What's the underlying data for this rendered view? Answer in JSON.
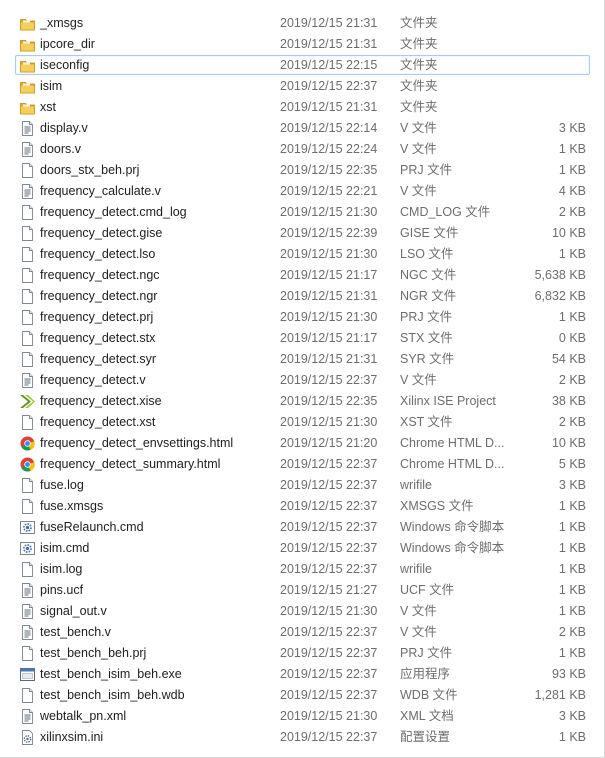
{
  "files": [
    {
      "name": "_xmsgs",
      "date": "2019/12/15 21:31",
      "type": "文件夹",
      "size": "",
      "icon": "folder-icon"
    },
    {
      "name": "ipcore_dir",
      "date": "2019/12/15 21:31",
      "type": "文件夹",
      "size": "",
      "icon": "folder-icon"
    },
    {
      "name": "iseconfig",
      "date": "2019/12/15 22:15",
      "type": "文件夹",
      "size": "",
      "icon": "folder-icon",
      "selected": true
    },
    {
      "name": "isim",
      "date": "2019/12/15 22:37",
      "type": "文件夹",
      "size": "",
      "icon": "folder-icon"
    },
    {
      "name": "xst",
      "date": "2019/12/15 21:31",
      "type": "文件夹",
      "size": "",
      "icon": "folder-icon"
    },
    {
      "name": "display.v",
      "date": "2019/12/15 22:14",
      "type": "V 文件",
      "size": "3 KB",
      "icon": "text-file-icon"
    },
    {
      "name": "doors.v",
      "date": "2019/12/15 22:24",
      "type": "V 文件",
      "size": "1 KB",
      "icon": "text-file-icon"
    },
    {
      "name": "doors_stx_beh.prj",
      "date": "2019/12/15 22:35",
      "type": "PRJ 文件",
      "size": "1 KB",
      "icon": "blank-file-icon"
    },
    {
      "name": "frequency_calculate.v",
      "date": "2019/12/15 22:21",
      "type": "V 文件",
      "size": "4 KB",
      "icon": "text-file-icon"
    },
    {
      "name": "frequency_detect.cmd_log",
      "date": "2019/12/15 21:30",
      "type": "CMD_LOG 文件",
      "size": "2 KB",
      "icon": "blank-file-icon"
    },
    {
      "name": "frequency_detect.gise",
      "date": "2019/12/15 22:39",
      "type": "GISE 文件",
      "size": "10 KB",
      "icon": "blank-file-icon"
    },
    {
      "name": "frequency_detect.lso",
      "date": "2019/12/15 21:30",
      "type": "LSO 文件",
      "size": "1 KB",
      "icon": "blank-file-icon"
    },
    {
      "name": "frequency_detect.ngc",
      "date": "2019/12/15 21:17",
      "type": "NGC 文件",
      "size": "5,638 KB",
      "icon": "blank-file-icon"
    },
    {
      "name": "frequency_detect.ngr",
      "date": "2019/12/15 21:31",
      "type": "NGR 文件",
      "size": "6,832 KB",
      "icon": "blank-file-icon"
    },
    {
      "name": "frequency_detect.prj",
      "date": "2019/12/15 21:30",
      "type": "PRJ 文件",
      "size": "1 KB",
      "icon": "blank-file-icon"
    },
    {
      "name": "frequency_detect.stx",
      "date": "2019/12/15 21:17",
      "type": "STX 文件",
      "size": "0 KB",
      "icon": "blank-file-icon"
    },
    {
      "name": "frequency_detect.syr",
      "date": "2019/12/15 21:31",
      "type": "SYR 文件",
      "size": "54 KB",
      "icon": "blank-file-icon"
    },
    {
      "name": "frequency_detect.v",
      "date": "2019/12/15 22:37",
      "type": "V 文件",
      "size": "2 KB",
      "icon": "text-file-icon"
    },
    {
      "name": "frequency_detect.xise",
      "date": "2019/12/15 22:35",
      "type": "Xilinx ISE Project",
      "size": "38 KB",
      "icon": "xilinx-ise-icon"
    },
    {
      "name": "frequency_detect.xst",
      "date": "2019/12/15 21:30",
      "type": "XST 文件",
      "size": "2 KB",
      "icon": "blank-file-icon"
    },
    {
      "name": "frequency_detect_envsettings.html",
      "date": "2019/12/15 21:20",
      "type": "Chrome HTML D...",
      "size": "10 KB",
      "icon": "chrome-icon"
    },
    {
      "name": "frequency_detect_summary.html",
      "date": "2019/12/15 22:37",
      "type": "Chrome HTML D...",
      "size": "5 KB",
      "icon": "chrome-icon"
    },
    {
      "name": "fuse.log",
      "date": "2019/12/15 22:37",
      "type": "wrifile",
      "size": "3 KB",
      "icon": "blank-file-icon"
    },
    {
      "name": "fuse.xmsgs",
      "date": "2019/12/15 22:37",
      "type": "XMSGS 文件",
      "size": "1 KB",
      "icon": "blank-file-icon"
    },
    {
      "name": "fuseRelaunch.cmd",
      "date": "2019/12/15 22:37",
      "type": "Windows 命令脚本",
      "size": "1 KB",
      "icon": "gear-file-icon"
    },
    {
      "name": "isim.cmd",
      "date": "2019/12/15 22:37",
      "type": "Windows 命令脚本",
      "size": "1 KB",
      "icon": "gear-file-icon"
    },
    {
      "name": "isim.log",
      "date": "2019/12/15 22:37",
      "type": "wrifile",
      "size": "1 KB",
      "icon": "blank-file-icon"
    },
    {
      "name": "pins.ucf",
      "date": "2019/12/15 21:27",
      "type": "UCF 文件",
      "size": "1 KB",
      "icon": "text-file-icon"
    },
    {
      "name": "signal_out.v",
      "date": "2019/12/15 21:30",
      "type": "V 文件",
      "size": "1 KB",
      "icon": "text-file-icon"
    },
    {
      "name": "test_bench.v",
      "date": "2019/12/15 22:37",
      "type": "V 文件",
      "size": "2 KB",
      "icon": "text-file-icon"
    },
    {
      "name": "test_bench_beh.prj",
      "date": "2019/12/15 22:37",
      "type": "PRJ 文件",
      "size": "1 KB",
      "icon": "blank-file-icon"
    },
    {
      "name": "test_bench_isim_beh.exe",
      "date": "2019/12/15 22:37",
      "type": "应用程序",
      "size": "93 KB",
      "icon": "exe-icon"
    },
    {
      "name": "test_bench_isim_beh.wdb",
      "date": "2019/12/15 22:37",
      "type": "WDB 文件",
      "size": "1,281 KB",
      "icon": "blank-file-icon"
    },
    {
      "name": "webtalk_pn.xml",
      "date": "2019/12/15 21:30",
      "type": "XML 文档",
      "size": "3 KB",
      "icon": "text-file-icon"
    },
    {
      "name": "xilinxsim.ini",
      "date": "2019/12/15 22:37",
      "type": "配置设置",
      "size": "1 KB",
      "icon": "ini-file-icon"
    }
  ],
  "colors": {
    "selection_border": "#aacbe9",
    "folder": "#e8b83a",
    "secondary_text": "#6d6d6d"
  }
}
